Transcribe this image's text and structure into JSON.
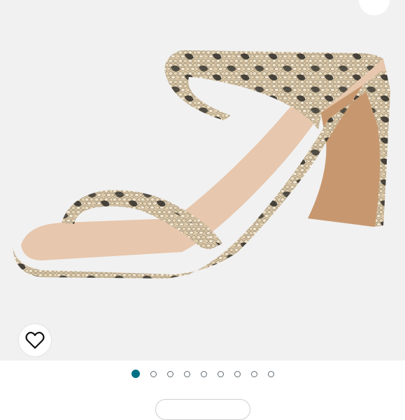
{
  "colors": {
    "gallery_bg": "#f1f1f1",
    "active_dot": "#007185",
    "inactive_dot_border": "#5f6b73"
  },
  "icons": {
    "wishlist": "heart-outline-icon"
  },
  "carousel": {
    "count": 9,
    "active_index": 0
  }
}
